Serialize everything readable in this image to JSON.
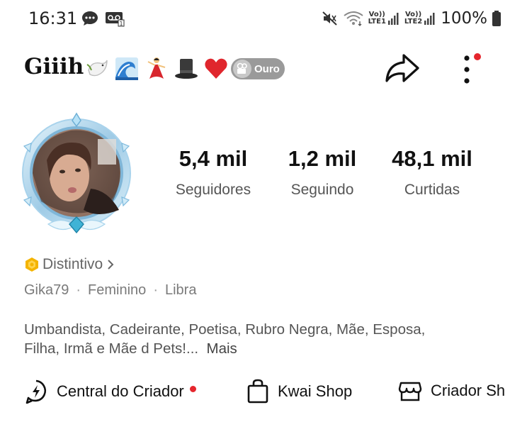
{
  "status_bar": {
    "time": "16:31",
    "network_1": [
      "Vo))",
      "LTE1"
    ],
    "network_2": [
      "Vo))",
      "LTE2"
    ],
    "battery": "100%",
    "icons": [
      "chat-icon",
      "voicemail-icon",
      "mute-icon",
      "wifi-icon",
      "signal-icon",
      "battery-icon"
    ]
  },
  "header": {
    "name": "Giiih",
    "emojis": [
      "dove-icon",
      "wave-icon",
      "dancer-icon",
      "top-hat-icon",
      "heart-icon"
    ],
    "badge_label": "Ouro"
  },
  "stats": {
    "followers_value": "5,4 mil",
    "followers_label": "Seguidores",
    "following_value": "1,2 mil",
    "following_label": "Seguindo",
    "likes_value": "48,1 mil",
    "likes_label": "Curtidas"
  },
  "badge_link": "Distintivo",
  "info": {
    "username": "Gika79",
    "gender": "Feminino",
    "sign": "Libra",
    "separator": "·"
  },
  "bio": {
    "line1": "Umbandista, Cadeirante, Poetisa, Rubro Negra, Mãe, Esposa,",
    "line2": "Filha, Irmã e Mãe d Pets!...",
    "more": "Mais"
  },
  "tools": {
    "creator_center": "Central do Criador",
    "kwai_shop": "Kwai Shop",
    "creator_shop": "Criador Sh"
  },
  "colors": {
    "accent_red": "#e5262d",
    "badge_grey": "#9a9a9a",
    "frame_blue": "#8fc6e6"
  }
}
